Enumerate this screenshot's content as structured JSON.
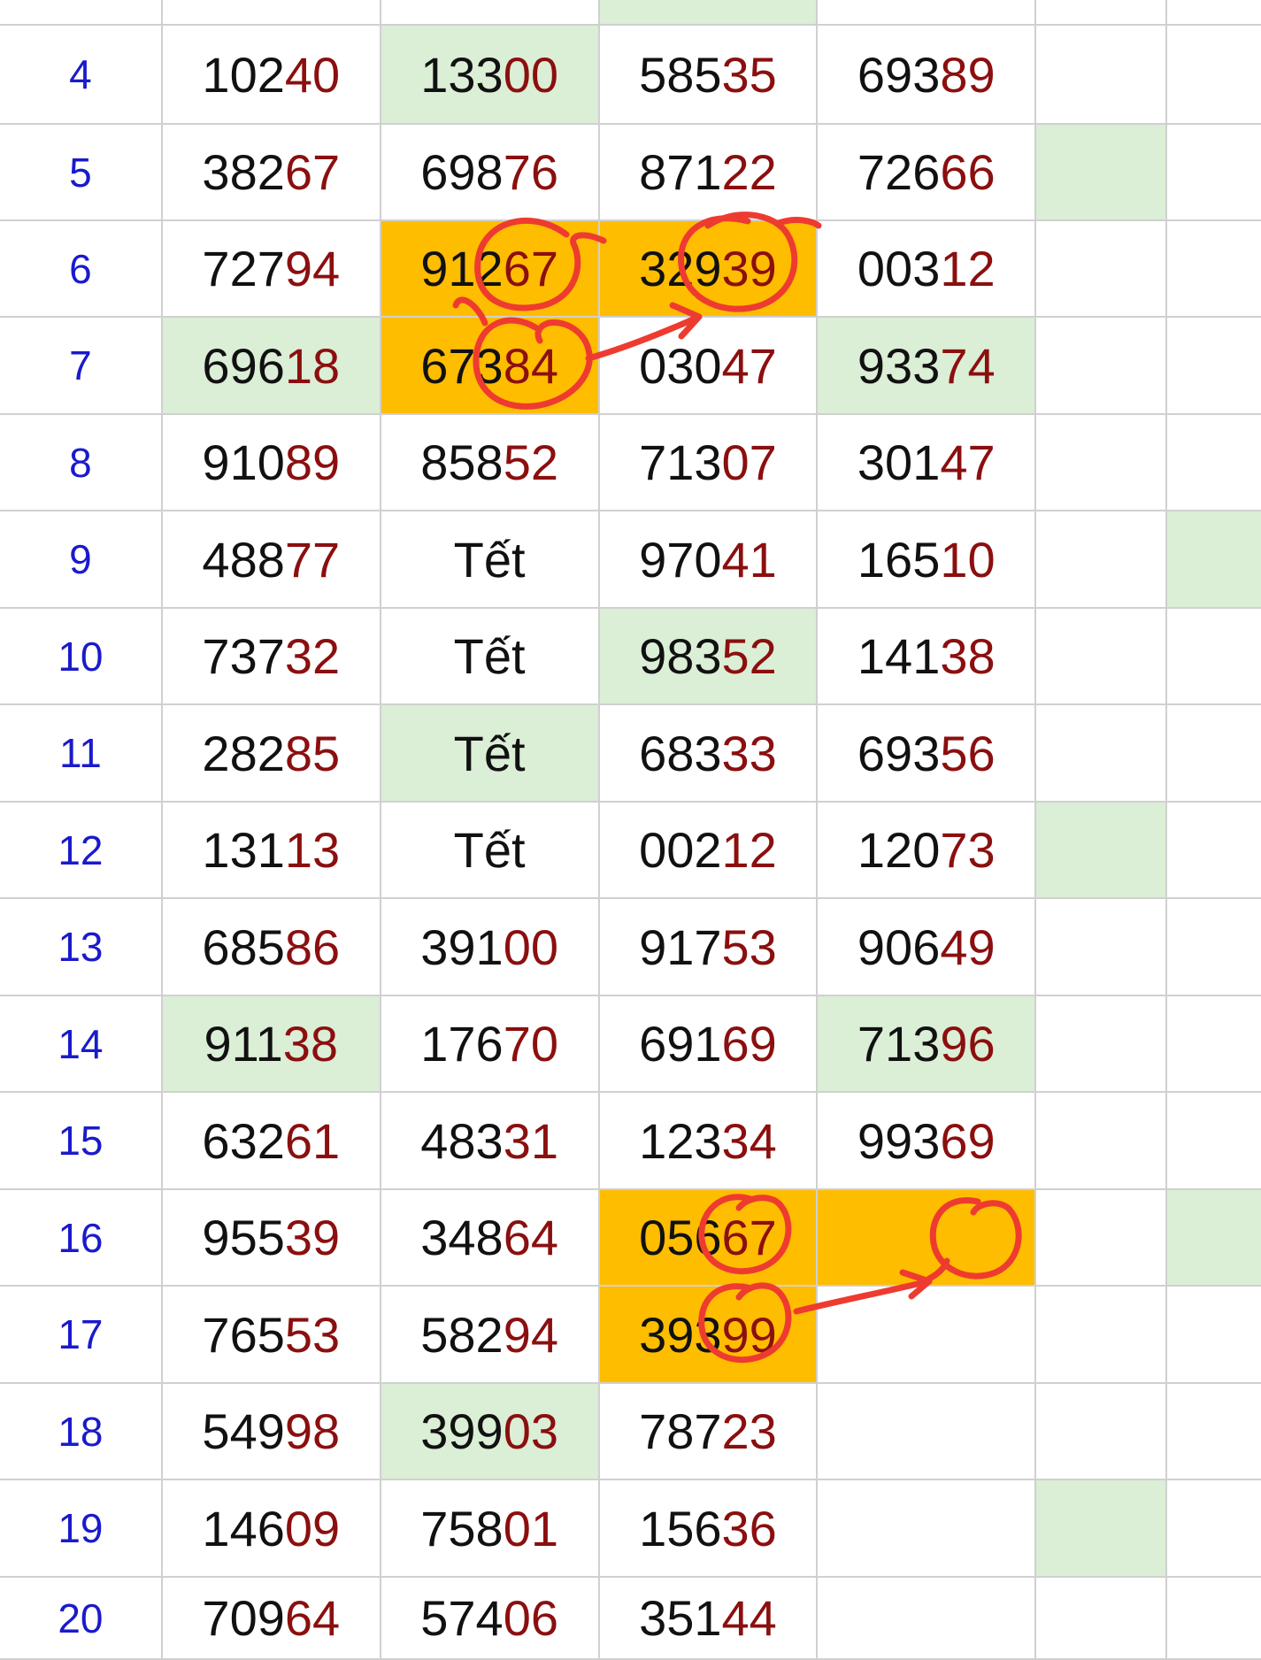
{
  "colors": {
    "green": "#dbeed6",
    "orange": "#ffbd00",
    "annotation": "#ee3b30",
    "index": "#1a1acc",
    "suffix": "#8b0f0f"
  },
  "rows": [
    {
      "index": "",
      "cells": [
        {
          "t": ""
        },
        {
          "t": ""
        },
        {
          "t": ""
        },
        {
          "t": ""
        }
      ],
      "hl": [
        "",
        "",
        "green",
        ""
      ],
      "extra": [
        "",
        ""
      ]
    },
    {
      "index": "4",
      "cells": [
        {
          "p": "102",
          "s": "40"
        },
        {
          "p": "133",
          "s": "00"
        },
        {
          "p": "585",
          "s": "35"
        },
        {
          "p": "693",
          "s": "89"
        }
      ],
      "hl": [
        "",
        "green",
        "",
        ""
      ],
      "extra": [
        "",
        ""
      ]
    },
    {
      "index": "5",
      "cells": [
        {
          "p": "382",
          "s": "67"
        },
        {
          "p": "698",
          "s": "76"
        },
        {
          "p": "871",
          "s": "22"
        },
        {
          "p": "726",
          "s": "66"
        }
      ],
      "hl": [
        "",
        "",
        "",
        ""
      ],
      "extra": [
        "green",
        ""
      ]
    },
    {
      "index": "6",
      "cells": [
        {
          "p": "727",
          "s": "94"
        },
        {
          "p": "912",
          "s": "67"
        },
        {
          "p": "329",
          "s": "39"
        },
        {
          "p": "003",
          "s": "12"
        }
      ],
      "hl": [
        "",
        "orange",
        "orange",
        ""
      ],
      "extra": [
        "",
        ""
      ]
    },
    {
      "index": "7",
      "cells": [
        {
          "p": "696",
          "s": "18"
        },
        {
          "p": "673",
          "s": "84"
        },
        {
          "p": "030",
          "s": "47"
        },
        {
          "p": "933",
          "s": "74"
        }
      ],
      "hl": [
        "green",
        "orange",
        "",
        "green"
      ],
      "extra": [
        "",
        ""
      ]
    },
    {
      "index": "8",
      "cells": [
        {
          "p": "910",
          "s": "89"
        },
        {
          "p": "858",
          "s": "52"
        },
        {
          "p": "713",
          "s": "07"
        },
        {
          "p": "301",
          "s": "47"
        }
      ],
      "hl": [
        "",
        "",
        "",
        ""
      ],
      "extra": [
        "",
        ""
      ]
    },
    {
      "index": "9",
      "cells": [
        {
          "p": "488",
          "s": "77"
        },
        {
          "t": "Tết"
        },
        {
          "p": "970",
          "s": "41"
        },
        {
          "p": "165",
          "s": "10"
        }
      ],
      "hl": [
        "",
        "",
        "",
        ""
      ],
      "extra": [
        "",
        "green"
      ]
    },
    {
      "index": "10",
      "cells": [
        {
          "p": "737",
          "s": "32"
        },
        {
          "t": "Tết"
        },
        {
          "p": "983",
          "s": "52"
        },
        {
          "p": "141",
          "s": "38"
        }
      ],
      "hl": [
        "",
        "",
        "green",
        ""
      ],
      "extra": [
        "",
        ""
      ]
    },
    {
      "index": "11",
      "cells": [
        {
          "p": "282",
          "s": "85"
        },
        {
          "t": "Tết"
        },
        {
          "p": "683",
          "s": "33"
        },
        {
          "p": "693",
          "s": "56"
        }
      ],
      "hl": [
        "",
        "green",
        "",
        ""
      ],
      "extra": [
        "",
        ""
      ]
    },
    {
      "index": "12",
      "cells": [
        {
          "p": "131",
          "s": "13"
        },
        {
          "t": "Tết"
        },
        {
          "p": "002",
          "s": "12"
        },
        {
          "p": "120",
          "s": "73"
        }
      ],
      "hl": [
        "",
        "",
        "",
        ""
      ],
      "extra": [
        "green",
        ""
      ]
    },
    {
      "index": "13",
      "cells": [
        {
          "p": "685",
          "s": "86"
        },
        {
          "p": "391",
          "s": "00"
        },
        {
          "p": "917",
          "s": "53"
        },
        {
          "p": "906",
          "s": "49"
        }
      ],
      "hl": [
        "",
        "",
        "",
        ""
      ],
      "extra": [
        "",
        ""
      ]
    },
    {
      "index": "14",
      "cells": [
        {
          "p": "911",
          "s": "38"
        },
        {
          "p": "176",
          "s": "70"
        },
        {
          "p": "691",
          "s": "69"
        },
        {
          "p": "713",
          "s": "96"
        }
      ],
      "hl": [
        "green",
        "",
        "",
        "green"
      ],
      "extra": [
        "",
        ""
      ]
    },
    {
      "index": "15",
      "cells": [
        {
          "p": "632",
          "s": "61"
        },
        {
          "p": "483",
          "s": "31"
        },
        {
          "p": "123",
          "s": "34"
        },
        {
          "p": "993",
          "s": "69"
        }
      ],
      "hl": [
        "",
        "",
        "",
        ""
      ],
      "extra": [
        "",
        ""
      ]
    },
    {
      "index": "16",
      "cells": [
        {
          "p": "955",
          "s": "39"
        },
        {
          "p": "348",
          "s": "64"
        },
        {
          "p": "056",
          "s": "67"
        },
        {
          "t": ""
        }
      ],
      "hl": [
        "",
        "",
        "orange",
        "orange"
      ],
      "extra": [
        "",
        "green"
      ]
    },
    {
      "index": "17",
      "cells": [
        {
          "p": "765",
          "s": "53"
        },
        {
          "p": "582",
          "s": "94"
        },
        {
          "p": "393",
          "s": "99"
        },
        {
          "t": ""
        }
      ],
      "hl": [
        "",
        "",
        "orange",
        ""
      ],
      "extra": [
        "",
        ""
      ]
    },
    {
      "index": "18",
      "cells": [
        {
          "p": "549",
          "s": "98"
        },
        {
          "p": "399",
          "s": "03"
        },
        {
          "p": "787",
          "s": "23"
        },
        {
          "t": ""
        }
      ],
      "hl": [
        "",
        "green",
        "",
        ""
      ],
      "extra": [
        "",
        ""
      ]
    },
    {
      "index": "19",
      "cells": [
        {
          "p": "146",
          "s": "09"
        },
        {
          "p": "758",
          "s": "01"
        },
        {
          "p": "156",
          "s": "36"
        },
        {
          "t": ""
        }
      ],
      "hl": [
        "",
        "",
        "",
        ""
      ],
      "extra": [
        "green",
        ""
      ]
    },
    {
      "index": "20",
      "cells": [
        {
          "p": "709",
          "s": "64"
        },
        {
          "p": "574",
          "s": "06"
        },
        {
          "p": "351",
          "s": "44"
        },
        {
          "t": ""
        }
      ],
      "hl": [
        "",
        "",
        "",
        ""
      ],
      "extra": [
        "",
        ""
      ]
    }
  ]
}
